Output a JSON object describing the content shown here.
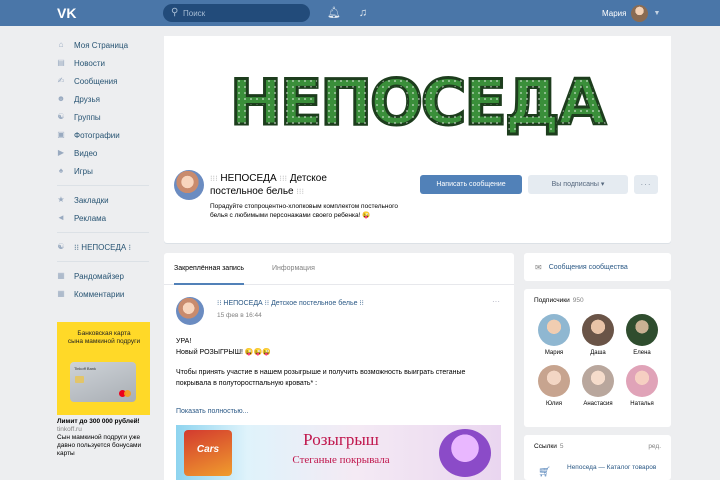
{
  "header": {
    "logo": "VK",
    "search_placeholder": "Поиск",
    "search_icon": "search-icon",
    "bell_icon": "bell-icon",
    "music_icon": "music-icon",
    "user_name": "Мария",
    "chevron_icon": "chevron-down-icon"
  },
  "nav": {
    "items": [
      {
        "label": "Моя Страница",
        "icon": "home-icon"
      },
      {
        "label": "Новости",
        "icon": "news-icon"
      },
      {
        "label": "Сообщения",
        "icon": "messages-icon"
      },
      {
        "label": "Друзья",
        "icon": "friends-icon"
      },
      {
        "label": "Группы",
        "icon": "groups-icon"
      },
      {
        "label": "Фотографии",
        "icon": "photos-icon"
      },
      {
        "label": "Видео",
        "icon": "video-icon"
      },
      {
        "label": "Игры",
        "icon": "games-icon"
      }
    ],
    "items2": [
      {
        "label": "Закладки",
        "icon": "star-icon"
      },
      {
        "label": "Реклама",
        "icon": "ads-icon"
      }
    ],
    "items3": [
      {
        "label": "⁝⁝ НЕПОСЕДА ⁝",
        "icon": "group-icon"
      }
    ],
    "items4": [
      {
        "label": "Рандомайзер",
        "icon": "app-icon"
      },
      {
        "label": "Комментарии",
        "icon": "app-icon"
      }
    ]
  },
  "ad": {
    "title": "Банковская карта\nсына мамкиной подруги",
    "card_brand": "Tinkoff Bank",
    "headline": "Лимит до 300 000 рублей!",
    "domain": "tinkoff.ru",
    "text": "Сын мамкиной подруги уже давно пользуется бонусами карты"
  },
  "profile": {
    "cover_title": "НЕПОСЕДА",
    "name_sym_left": "⁝⁝⁝",
    "name": "НЕПОСЕДА",
    "name_sym_mid": "⁝⁝⁝",
    "name_rest_1": "Детское",
    "name_rest_2": "постельное белье",
    "name_sym_end": "⁝⁝⁝",
    "status": "Порадуйте стопроцентно-хлопковым комплектом постельного белья с любимыми персонажами своего ребенка! 😜",
    "btn_message": "Написать сообщение",
    "btn_subscribed": "Вы подписаны",
    "btn_subscribed_caret": "▾",
    "btn_more": "···"
  },
  "wall": {
    "tabs": [
      "Закреплённая запись",
      "Информация"
    ],
    "post": {
      "author": "⁝⁝ НЕПОСЕДА ⁝⁝ Детское постельное белье ⁝⁝",
      "date": "15 фев в 16:44",
      "menu": "···",
      "line1": "УРА!",
      "line2": "Новый РОЗЫГРЫШ! 😜😜😜",
      "line3": "Чтобы принять участие в нашем розыгрыше и получить возможность выиграть стеганые покрывала в полуторостпальную кровать* :",
      "show_more": "Показать полностью...",
      "banner_left": "Cars",
      "banner_t1": "Розыгрыш",
      "banner_t2": "Стеганые покрывала"
    }
  },
  "right": {
    "messages_label": "Сообщения сообщества",
    "messages_icon": "chat-icon",
    "subscribers_label": "Подписчики",
    "subscribers_count": "950",
    "subscribers": [
      {
        "name": "Мария",
        "color": "#8fb7d1"
      },
      {
        "name": "Даша",
        "color": "#6a5447"
      },
      {
        "name": "Елена",
        "color": "#2f4d2e"
      },
      {
        "name": "Юлия",
        "color": "#c7a48f"
      },
      {
        "name": "Анастасия",
        "color": "#b9a79d"
      },
      {
        "name": "Наталья",
        "color": "#e0a3b8"
      }
    ],
    "links_label": "Ссылки",
    "links_count": "5",
    "links_edit": "ред.",
    "link_title": "Непоседа — Каталог товаров",
    "link_icon": "cart-icon"
  }
}
